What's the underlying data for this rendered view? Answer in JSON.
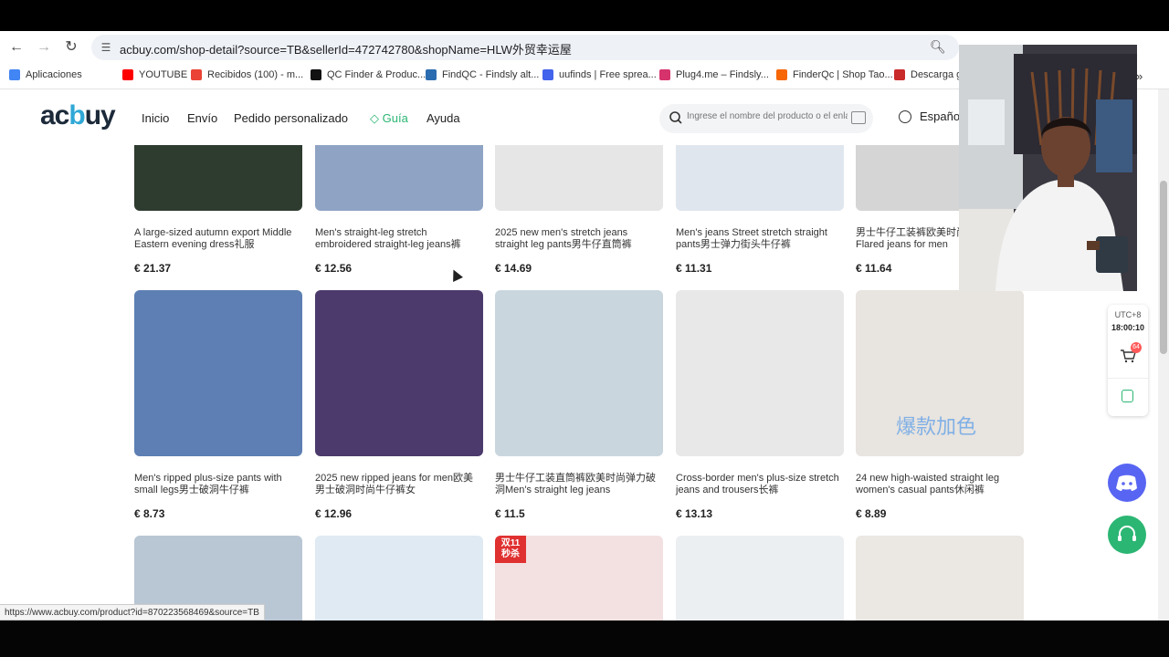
{
  "browser": {
    "url": "acbuy.com/shop-detail?source=TB&sellerId=472742780&shopName=HLW外贸幸运屋",
    "status_url": "https://www.acbuy.com/product?id=870223568469&source=TB",
    "bookmarks": [
      {
        "label": "Aplicaciones",
        "icon": "apps-icon",
        "color": "#4285f4"
      },
      {
        "label": "YOUTUBE",
        "icon": "youtube-icon",
        "color": "#ff0000"
      },
      {
        "label": "Recibidos (100) - m...",
        "icon": "gmail-icon",
        "color": "#ea4335"
      },
      {
        "label": "QC Finder & Produc...",
        "icon": "tiktok-icon",
        "color": "#111111"
      },
      {
        "label": "FindQC - Findsly alt...",
        "icon": "findqc-icon",
        "color": "#2b6cb0"
      },
      {
        "label": "uufinds | Free sprea...",
        "icon": "uufinds-icon",
        "color": "#4263eb"
      },
      {
        "label": "Plug4.me – Findsly...",
        "icon": "plug4me-icon",
        "color": "#d6336c"
      },
      {
        "label": "FinderQc | Shop Tao...",
        "icon": "finderqc-icon",
        "color": "#f76707"
      },
      {
        "label": "Descarga gr",
        "icon": "descarga-icon",
        "color": "#c92a2a"
      }
    ]
  },
  "site": {
    "logo_left": "ac",
    "logo_mid": "b",
    "logo_right": "uy",
    "nav": [
      "Inicio",
      "Envío",
      "Pedido personalizado",
      "Guía",
      "Ayuda"
    ],
    "search_placeholder": "Ingrese el nombre del producto o el enlace",
    "language": "Español",
    "accent_color": "#2bb673"
  },
  "products": [
    {
      "title": "A large-sized autumn export Middle Eastern evening dress礼服",
      "price": "€ 21.37"
    },
    {
      "title": "Men's straight-leg stretch embroidered straight-leg jeans裤",
      "price": "€ 12.56"
    },
    {
      "title": "2025 new men's stretch jeans straight leg pants男牛仔直筒裤",
      "price": "€ 14.69"
    },
    {
      "title": "Men's jeans Street stretch straight pants男士弹力街头牛仔裤",
      "price": "€ 11.31"
    },
    {
      "title": "男士牛仔工装裤欧美时尚喇叭裤Flared jeans for men",
      "price": "€ 11.64"
    },
    {
      "title": "Men's ripped plus-size pants with small legs男士破洞牛仔裤",
      "price": "€ 8.73"
    },
    {
      "title": "2025 new ripped jeans for men欧美男士破洞时尚牛仔裤女",
      "price": "€ 12.96"
    },
    {
      "title": "男士牛仔工装直筒裤欧美时尚弹力破洞Men's straight leg jeans",
      "price": "€ 11.5"
    },
    {
      "title": "Cross-border men's plus-size stretch jeans and trousers长裤",
      "price": "€ 13.13"
    },
    {
      "title": "24 new high-waisted straight leg women's casual pants休闲裤",
      "price": "€ 8.89"
    },
    {
      "title": "",
      "price": ""
    },
    {
      "title": "",
      "price": ""
    },
    {
      "title": "",
      "price": ""
    },
    {
      "title": "",
      "price": ""
    },
    {
      "title": "",
      "price": ""
    }
  ],
  "image_overlay_text": "爆款加色",
  "promo_badge": "双11 秒杀",
  "side_panel": {
    "timezone": "UTC+8",
    "time": "18:00:10",
    "cart_count": "64"
  }
}
